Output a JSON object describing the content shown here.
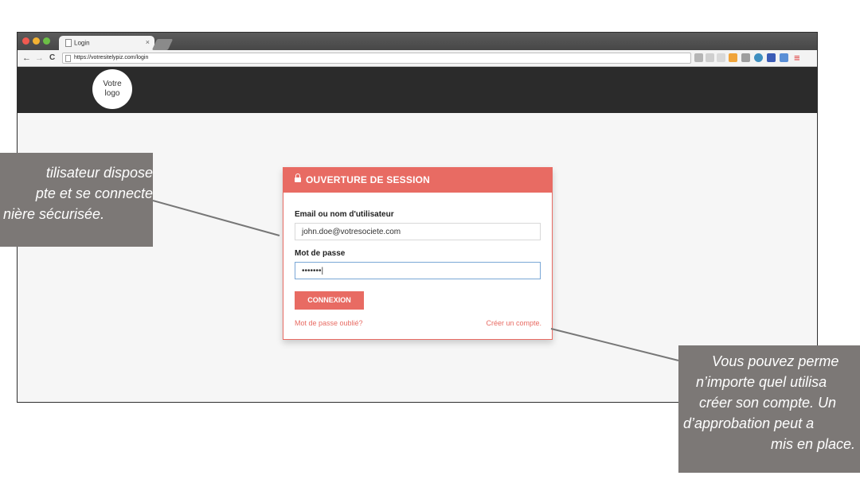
{
  "browser": {
    "tab_title": "Login",
    "tab_close": "×",
    "url": "https://votresitelypiz.com/login",
    "nav": {
      "back": "←",
      "forward": "→",
      "reload": "C"
    }
  },
  "site": {
    "logo_text": "Votre\nlogo"
  },
  "login": {
    "header": "OUVERTURE DE SESSION",
    "username_label": "Email ou nom d'utilisateur",
    "username_value": "john.doe@votresociete.com",
    "password_label": "Mot de passe",
    "password_value": "•••••••|",
    "submit_label": "CONNEXION",
    "forgot_link": "Mot de passe oublié?",
    "create_link": "Créer un compte."
  },
  "callouts": {
    "left": [
      "tilisateur dispose",
      "pte et se connecte",
      "nière sécurisée."
    ],
    "right": [
      "Vous pouvez perme",
      "n’importe quel utilisa",
      "créer son compte. Un",
      "d’approbation peut a",
      "mis en place."
    ]
  },
  "colors": {
    "accent": "#e86b63",
    "header_bg": "#2b2b2b",
    "callout_bg": "#7c7876"
  }
}
